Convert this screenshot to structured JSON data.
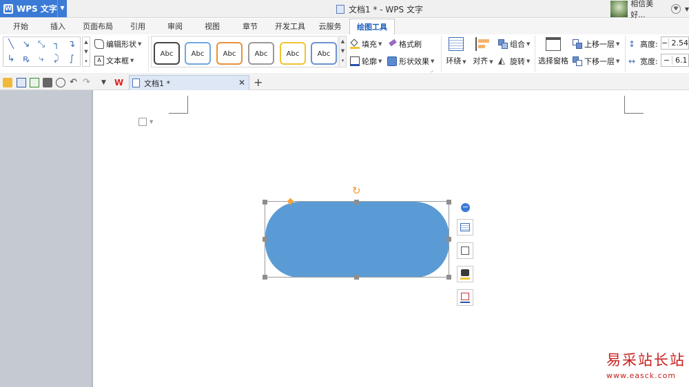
{
  "app": {
    "title": "WPS 文字",
    "window_title": "文档1 * - WPS 文字"
  },
  "user": {
    "name": "相信美好..."
  },
  "menu_tabs": [
    {
      "label": "开始"
    },
    {
      "label": "插入"
    },
    {
      "label": "页面布局"
    },
    {
      "label": "引用"
    },
    {
      "label": "审阅"
    },
    {
      "label": "视图"
    },
    {
      "label": "章节"
    },
    {
      "label": "开发工具"
    },
    {
      "label": "云服务"
    },
    {
      "label": "绘图工具",
      "active": true
    }
  ],
  "ribbon": {
    "edit_shape": "编辑形状",
    "text_box": "文本框",
    "style_preset_label": "Abc",
    "style_preset_colors": [
      "#444444",
      "#6fa8dc",
      "#e69138",
      "#999999",
      "#f1c232",
      "#6d8fcf"
    ],
    "fill": "填充",
    "format_painter": "格式刷",
    "outline": "轮廓",
    "shape_effects": "形状效果",
    "wrap": "环绕",
    "align": "对齐",
    "group": "组合",
    "rotate": "旋转",
    "selection_pane": "选择窗格",
    "bring_forward": "上移一层",
    "send_backward": "下移一层",
    "height_label": "高度:",
    "height_value": "2.54",
    "width_label": "宽度:",
    "width_value": "6.1"
  },
  "document_tab": {
    "title": "文档1 *"
  },
  "shape": {
    "fill_color": "#5b9bd5",
    "type": "rounded-rectangle"
  },
  "watermark": {
    "text": "易采站长站",
    "url": "www.easck.com"
  }
}
